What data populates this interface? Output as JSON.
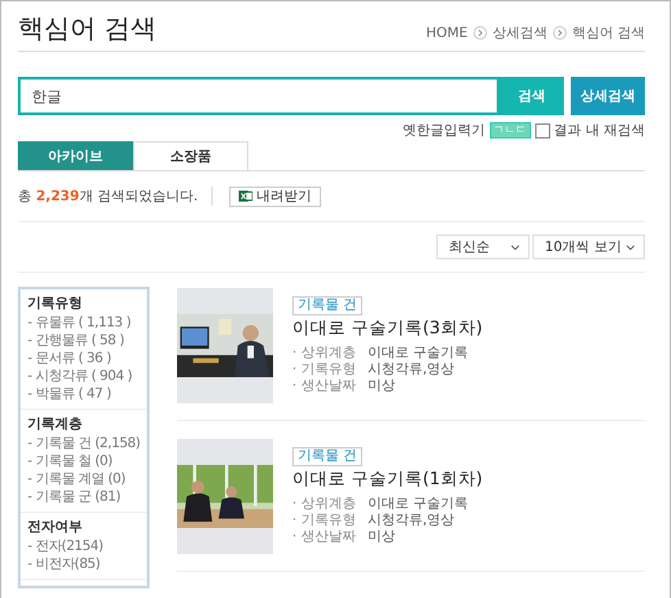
{
  "header": {
    "title": "핵심어 검색",
    "breadcrumb": [
      "HOME",
      "상세검색",
      "핵심어 검색"
    ]
  },
  "search": {
    "value": "한글",
    "search_button": "검색",
    "advanced_button": "상세검색",
    "keyboard_label": "옛한글입력기",
    "keyboard_badge": "ㄱㄴㄷ",
    "refine": {
      "label": "결과 내 재검색",
      "checked": false
    }
  },
  "tabs": [
    {
      "label": "아카이브",
      "selected": true
    },
    {
      "label": "소장품",
      "selected": false
    }
  ],
  "summary": {
    "prefix": "총 ",
    "count": "2,239",
    "suffix": "개 검색되었습니다.",
    "download_button": "내려받기"
  },
  "sort": {
    "order": "최신순",
    "page_size": "10개씩 보기"
  },
  "filters": [
    {
      "heading": "기록유형",
      "items": [
        "- 유물류 ( 1,113 )",
        "- 간행물류 ( 58 )",
        "- 문서류 ( 36 )",
        "- 시청각류 ( 904 )",
        "- 박물류 ( 47 )"
      ]
    },
    {
      "heading": "기록계층",
      "items": [
        "- 기록물 건 (2,158)",
        "- 기록물 철 (0)",
        "- 기록물 계열 (0)",
        "- 기록물 군 (81)"
      ]
    },
    {
      "heading": "전자여부",
      "items": [
        "- 전자(2154)",
        "- 비전자(85)"
      ]
    }
  ],
  "results": [
    {
      "tag": "기록물 건",
      "title": "이대로 구술기록(3회차)",
      "fields": [
        {
          "label": "· 상위계층",
          "value": "이대로 구술기록"
        },
        {
          "label": "· 기록유형",
          "value": "시청각류,영상"
        },
        {
          "label": "· 생산날짜",
          "value": "미상"
        }
      ]
    },
    {
      "tag": "기록물 건",
      "title": "이대로 구술기록(1회차)",
      "fields": [
        {
          "label": "· 상위계층",
          "value": "이대로 구술기록"
        },
        {
          "label": "· 기록유형",
          "value": "시청각류,영상"
        },
        {
          "label": "· 생산날짜",
          "value": "미상"
        }
      ]
    }
  ]
}
